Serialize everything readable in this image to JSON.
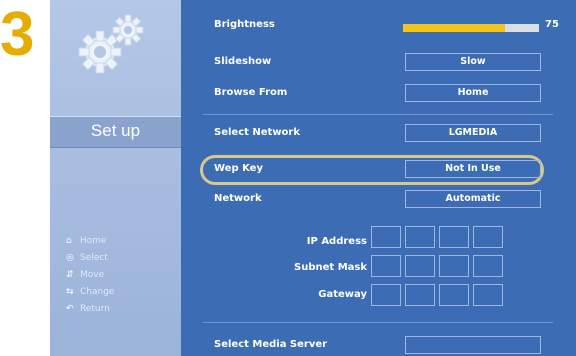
{
  "step_number": "3",
  "sidebar": {
    "title": "Set up",
    "legend": [
      {
        "icon": "home-icon",
        "glyph": "⌂",
        "label": "Home"
      },
      {
        "icon": "ok-icon",
        "glyph": "◎",
        "label": "Select"
      },
      {
        "icon": "arrows-icon",
        "glyph": "⇵",
        "label": "Move"
      },
      {
        "icon": "arrows-lr-icon",
        "glyph": "⇆",
        "label": "Change"
      },
      {
        "icon": "return-icon",
        "glyph": "↶",
        "label": "Return"
      }
    ]
  },
  "settings": {
    "brightness": {
      "label": "Brightness",
      "value": "75",
      "level": 75
    },
    "slideshow": {
      "label": "Slideshow",
      "value": "Slow"
    },
    "browse_from": {
      "label": "Browse From",
      "value": "Home"
    },
    "select_network": {
      "label": "Select Network",
      "value": "LGMEDIA"
    },
    "wep_key": {
      "label": "Wep Key",
      "value": "Not In Use"
    },
    "network": {
      "label": "Network",
      "value": "Automatic"
    },
    "ip_address": {
      "label": "IP Address"
    },
    "subnet_mask": {
      "label": "Subnet Mask"
    },
    "gateway": {
      "label": "Gateway"
    },
    "media_server": {
      "label": "Select Media Server",
      "value": ""
    }
  },
  "colors": {
    "accent": "#e6ad00",
    "panel": "#3c6cb3",
    "highlight": "#d8c98a"
  }
}
